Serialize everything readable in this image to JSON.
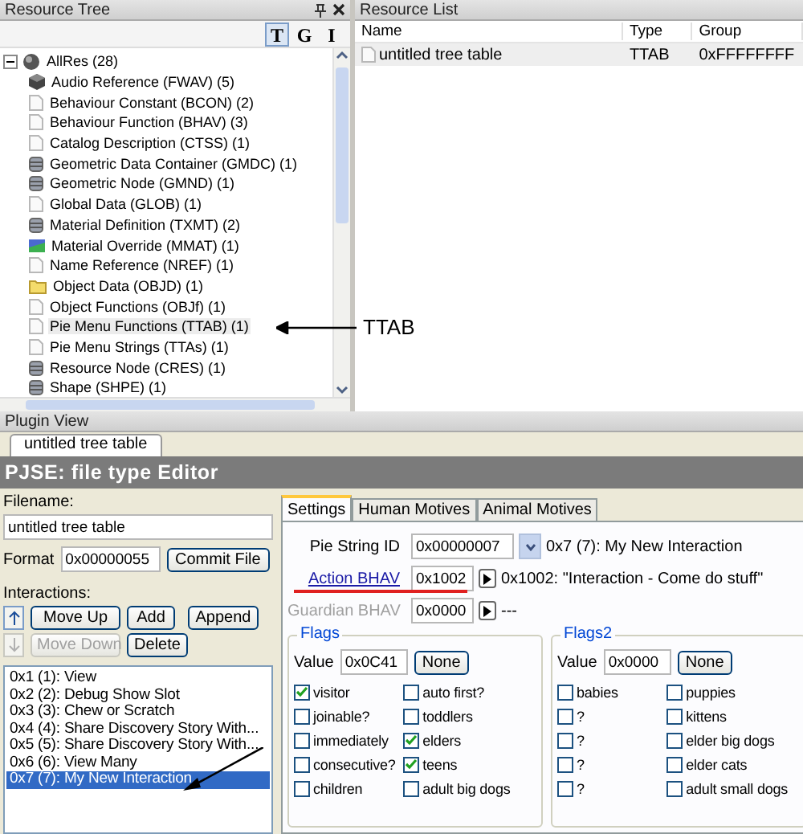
{
  "resource_tree": {
    "title": "Resource Tree",
    "view_buttons": [
      {
        "label": "T",
        "selected": true
      },
      {
        "label": "G",
        "selected": false
      },
      {
        "label": "I",
        "selected": false
      }
    ],
    "root": {
      "label": "AllRes (28)",
      "expanded": true,
      "children": [
        {
          "label": "Audio Reference (FWAV) (5)",
          "kind": "cube",
          "selected": false
        },
        {
          "label": "Behaviour Constant (BCON) (2)",
          "kind": "document",
          "selected": false
        },
        {
          "label": "Behaviour Function (BHAV) (3)",
          "kind": "document",
          "selected": false
        },
        {
          "label": "Catalog Description (CTSS) (1)",
          "kind": "document",
          "selected": false
        },
        {
          "label": "Geometric Data Container (GMDC) (1)",
          "kind": "database",
          "selected": false
        },
        {
          "label": "Geometric Node (GMND) (1)",
          "kind": "database",
          "selected": false
        },
        {
          "label": "Global Data (GLOB) (1)",
          "kind": "document",
          "selected": false
        },
        {
          "label": "Material Definition (TXMT) (2)",
          "kind": "database",
          "selected": false
        },
        {
          "label": "Material Override (MMAT) (1)",
          "kind": "material",
          "selected": false
        },
        {
          "label": "Name Reference (NREF) (1)",
          "kind": "document",
          "selected": false
        },
        {
          "label": "Object Data (OBJD) (1)",
          "kind": "folder",
          "selected": false
        },
        {
          "label": "Object Functions (OBJf) (1)",
          "kind": "document",
          "selected": false
        },
        {
          "label": "Pie Menu Functions (TTAB) (1)",
          "kind": "document",
          "selected": true
        },
        {
          "label": "Pie Menu Strings (TTAs) (1)",
          "kind": "document",
          "selected": false
        },
        {
          "label": "Resource Node (CRES) (1)",
          "kind": "database",
          "selected": false
        },
        {
          "label": "Shape (SHPE) (1)",
          "kind": "database",
          "selected": false
        }
      ]
    }
  },
  "annotation": {
    "label": "TTAB"
  },
  "resource_list": {
    "title": "Resource List",
    "columns": [
      "Name",
      "Type",
      "Group"
    ],
    "rows": [
      {
        "name": "untitled tree table",
        "type": "TTAB",
        "group": "0xFFFFFFFF",
        "selected": true
      }
    ]
  },
  "plugin_view": {
    "title": "Plugin View",
    "tabs": [
      {
        "label": "untitled tree table",
        "selected": true
      }
    ],
    "editor_title": "PJSE: file type Editor",
    "filename_label": "Filename:",
    "filename": "untitled tree table",
    "format_label": "Format",
    "format": "0x00000055",
    "commit_button": "Commit File",
    "interactions_label": "Interactions:",
    "buttons": [
      {
        "label": "Move Up",
        "disabled": false
      },
      {
        "label": "Add",
        "disabled": false
      },
      {
        "label": "Append",
        "disabled": false
      },
      {
        "label": "Move Down",
        "disabled": true
      },
      {
        "label": "Delete",
        "disabled": false
      }
    ],
    "interactions": [
      {
        "label": "0x1 (1): View",
        "selected": false
      },
      {
        "label": "0x2 (2): Debug Show Slot",
        "selected": false
      },
      {
        "label": "0x3 (3): Chew or Scratch",
        "selected": false
      },
      {
        "label": "0x4 (4): Share Discovery Story With...",
        "selected": false
      },
      {
        "label": "0x5 (5): Share Discovery Story With...",
        "selected": false
      },
      {
        "label": "0x6 (6): View Many",
        "selected": false
      },
      {
        "label": "0x7 (7): My New Interaction",
        "selected": true
      }
    ],
    "settings_tabs": [
      {
        "label": "Settings",
        "selected": true
      },
      {
        "label": "Human Motives",
        "selected": false
      },
      {
        "label": "Animal Motives",
        "selected": false
      }
    ],
    "fields": [
      {
        "kind": "dropdown",
        "label": "Pie String ID",
        "value": "0x00000007",
        "description": "0x7 (7): My New Interaction",
        "disabled": false
      },
      {
        "kind": "link",
        "label": "Action BHAV",
        "value": "0x1002",
        "description": "0x1002: \"Interaction - Come do stuff\"",
        "disabled": false
      },
      {
        "kind": "plain",
        "label": "Guardian BHAV",
        "value": "0x0000",
        "description": "---",
        "disabled": true
      }
    ],
    "flag_groups": [
      {
        "title": "Flags",
        "value_label": "Value",
        "value": "0x0C41",
        "none_button": "None",
        "columns": [
          [
            {
              "label": "visitor",
              "checked": true
            },
            {
              "label": "joinable?",
              "checked": false
            },
            {
              "label": "immediately",
              "checked": false
            },
            {
              "label": "consecutive?",
              "checked": false
            },
            {
              "label": "children",
              "checked": false
            }
          ],
          [
            {
              "label": "auto first?",
              "checked": false
            },
            {
              "label": "toddlers",
              "checked": false
            },
            {
              "label": "elders",
              "checked": true
            },
            {
              "label": "teens",
              "checked": true
            },
            {
              "label": "adult big dogs",
              "checked": false
            }
          ]
        ]
      },
      {
        "title": "Flags2",
        "value_label": "Value",
        "value": "0x0000",
        "none_button": "None",
        "columns": [
          [
            {
              "label": "babies",
              "checked": false
            },
            {
              "label": "?",
              "checked": false
            },
            {
              "label": "?",
              "checked": false
            },
            {
              "label": "?",
              "checked": false
            },
            {
              "label": "?",
              "checked": false
            }
          ],
          [
            {
              "label": "puppies",
              "checked": false
            },
            {
              "label": "kittens",
              "checked": false
            },
            {
              "label": "elder big dogs",
              "checked": false
            },
            {
              "label": "elder cats",
              "checked": false
            },
            {
              "label": "adult small dogs",
              "checked": false
            }
          ]
        ]
      }
    ]
  }
}
